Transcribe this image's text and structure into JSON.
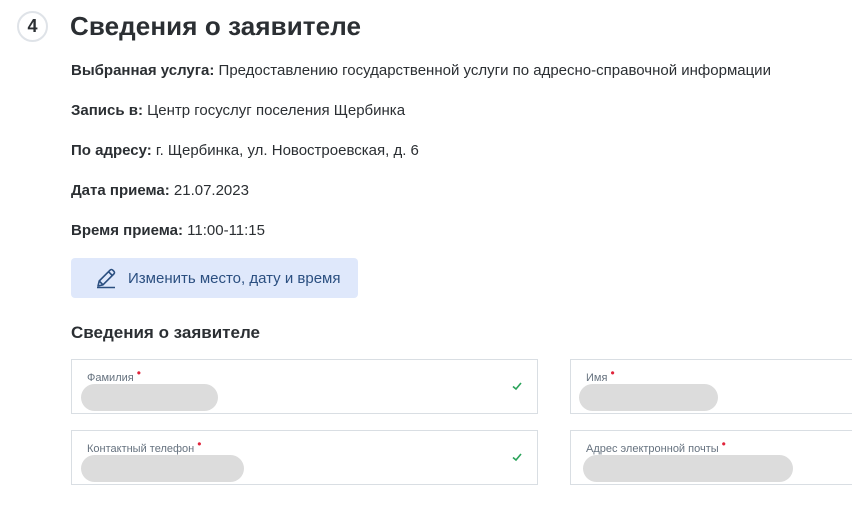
{
  "step": {
    "number": "4"
  },
  "page_title": "Сведения о заявителе",
  "details": [
    {
      "label": "Выбранная услуга:",
      "value": " Предоставлению государственной услуги по адресно-справочной информации"
    },
    {
      "label": "Запись в:",
      "value": " Центр госуслуг поселения Щербинка"
    },
    {
      "label": "По адресу:",
      "value": " г. Щербинка, ул. Новостроевская, д. 6"
    },
    {
      "label": "Дата приема:",
      "value": " 21.07.2023"
    },
    {
      "label": "Время приема:",
      "value": " 11:00-11:15"
    }
  ],
  "change_button": {
    "label": "Изменить место, дату и время",
    "icon": "pencil-icon"
  },
  "section_title": "Сведения о заявителе",
  "form": {
    "last_name": {
      "label": "Фамилия",
      "required_mark": "•",
      "valid": true
    },
    "first_name": {
      "label": "Имя",
      "required_mark": "•"
    },
    "phone": {
      "label": "Контактный телефон",
      "required_mark": "•",
      "valid": true
    },
    "email": {
      "label": "Адрес электронной почты",
      "required_mark": "•"
    }
  },
  "colors": {
    "accent_bg": "#dfe8fb",
    "accent_text": "#2b4f80",
    "required": "#e0243b",
    "valid": "#2aa35a"
  }
}
